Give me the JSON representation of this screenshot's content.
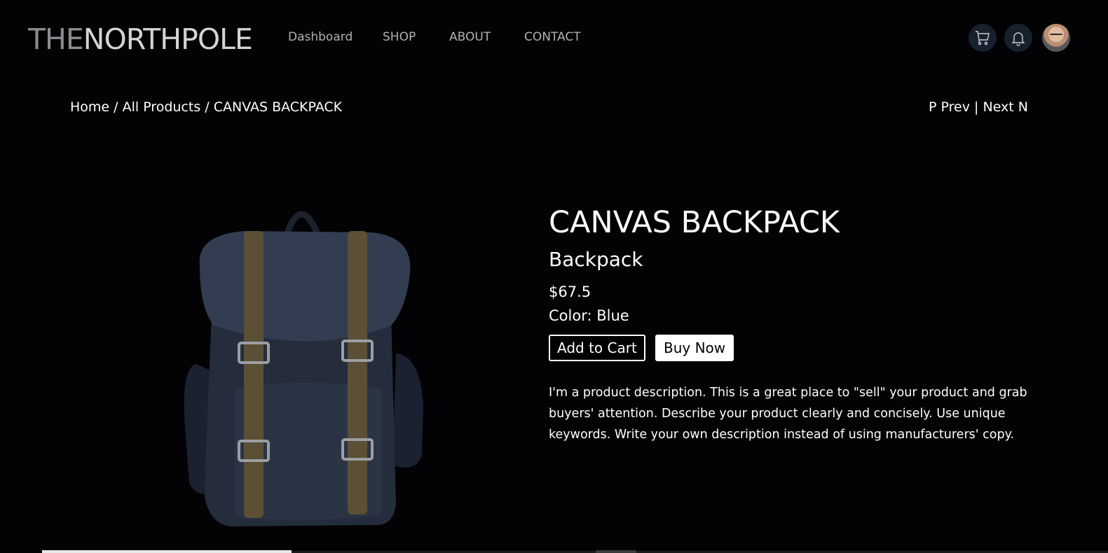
{
  "header": {
    "logo": {
      "part1": "THE",
      "part2": "NORTHPOLE"
    },
    "nav": [
      {
        "label": "Dashboard"
      },
      {
        "label": "SHOP"
      },
      {
        "label": "ABOUT"
      },
      {
        "label": "CONTACT"
      }
    ],
    "icons": [
      "cart-icon",
      "bell-icon",
      "avatar"
    ]
  },
  "breadcrumb": {
    "home": "Home",
    "sep1": " / ",
    "all_products": "All Products",
    "sep2": " / ",
    "current": "CANVAS BACKPACK"
  },
  "pager": {
    "prev": "P Prev",
    "divider": " | ",
    "next": "Next N"
  },
  "product": {
    "title": "CANVAS BACKPACK",
    "category": "Backpack",
    "price": "$67.5",
    "color_label": "Color: ",
    "color_value": "Blue",
    "add_to_cart": "Add to Cart",
    "buy_now": "Buy Now",
    "description": "I'm a product description. This is a great place to \"sell\" your product and grab buyers' attention. Describe your product clearly and concisely. Use unique keywords. Write your own description instead of using manufacturers' copy.",
    "image_alt": "backpack-image"
  },
  "colors": {
    "background": "#030204",
    "icon_circle": "#17212e",
    "backpack_body": "#28303f",
    "backpack_strap": "#5e5236",
    "nav_text": "#b1b1b5",
    "logo_dim": "#8e8e92"
  }
}
